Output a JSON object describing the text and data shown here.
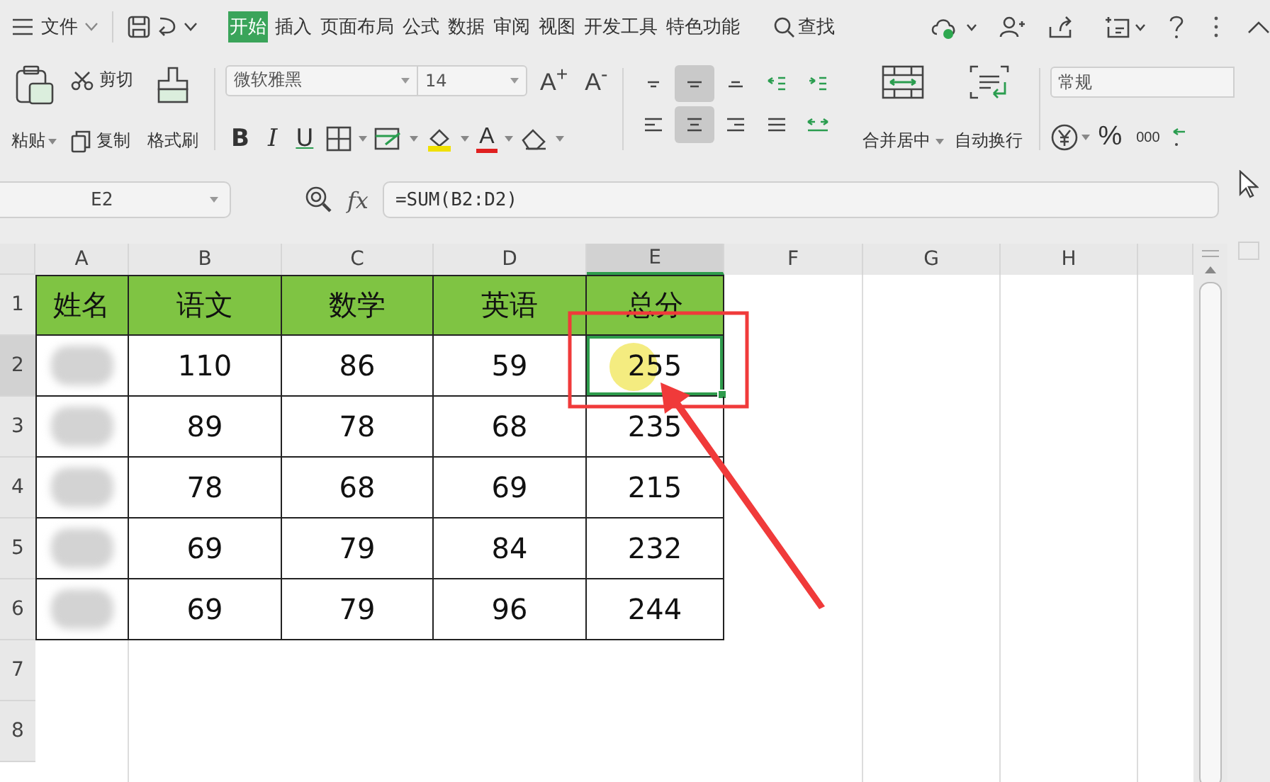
{
  "menu": {
    "file": "文件",
    "tabs": [
      {
        "label": "开始",
        "selected": true
      },
      {
        "label": "插入",
        "selected": false
      },
      {
        "label": "页面布局",
        "selected": false
      },
      {
        "label": "公式",
        "selected": false
      },
      {
        "label": "数据",
        "selected": false
      },
      {
        "label": "审阅",
        "selected": false
      },
      {
        "label": "视图",
        "selected": false
      },
      {
        "label": "开发工具",
        "selected": false
      },
      {
        "label": "特色功能",
        "selected": false
      }
    ],
    "search": "查找"
  },
  "ribbon": {
    "paste": "粘贴",
    "cut": "剪切",
    "copy": "复制",
    "format_painter": "格式刷",
    "font": "微软雅黑",
    "font_size": "14",
    "grow_font": "A$^{+}$",
    "shrink_font": "A$^{-}$",
    "font_styles": [
      "B",
      "I",
      "U"
    ],
    "font_color": "A",
    "align_buttons": [
      {
        "selected": false
      },
      {
        "selected": true
      },
      {
        "selected": false
      },
      {
        "selected": false
      },
      {
        "selected": false
      },
      {
        "selected": false
      },
      {
        "selected": true
      },
      {
        "selected": false
      },
      {
        "selected": false
      },
      {
        "selected": false
      }
    ],
    "merge": "合并居中",
    "wrap": "自动换行",
    "number_format": "常规",
    "percent": "%",
    "thousands": "000"
  },
  "formula_bar": {
    "name_box": "E2",
    "fx": "fx",
    "formula": "=SUM(B2:D2)"
  },
  "sheet": {
    "columns": [
      {
        "label": "A",
        "selected": false
      },
      {
        "label": "B",
        "selected": false
      },
      {
        "label": "C",
        "selected": false
      },
      {
        "label": "D",
        "selected": false
      },
      {
        "label": "E",
        "selected": true
      },
      {
        "label": "F",
        "selected": false
      },
      {
        "label": "G",
        "selected": false
      },
      {
        "label": "H",
        "selected": false
      }
    ],
    "rows": [
      {
        "number": "1",
        "kind": "heading",
        "selected": false,
        "cells": [
          "姓名",
          "语文",
          "数学",
          "英语",
          "总分"
        ]
      },
      {
        "number": "2",
        "kind": "data",
        "selected": true,
        "name": {
          "kind": "blurred"
        },
        "cells": [
          "110",
          "86",
          "59",
          "255"
        ]
      },
      {
        "number": "3",
        "kind": "data",
        "selected": false,
        "name": {
          "kind": "blurred"
        },
        "cells": [
          "89",
          "78",
          "68",
          "235"
        ]
      },
      {
        "number": "4",
        "kind": "data",
        "selected": false,
        "name": {
          "kind": "blurred"
        },
        "cells": [
          "78",
          "68",
          "69",
          "215"
        ]
      },
      {
        "number": "5",
        "kind": "data",
        "selected": false,
        "name": {
          "kind": "blurred"
        },
        "cells": [
          "69",
          "79",
          "84",
          "232"
        ]
      },
      {
        "number": "6",
        "kind": "data",
        "selected": false,
        "name": {
          "kind": "blurred"
        },
        "cells": [
          "69",
          "79",
          "96",
          "244"
        ]
      },
      {
        "number": "7",
        "kind": "empty",
        "selected": false
      },
      {
        "number": "8",
        "kind": "empty",
        "selected": false
      }
    ]
  }
}
